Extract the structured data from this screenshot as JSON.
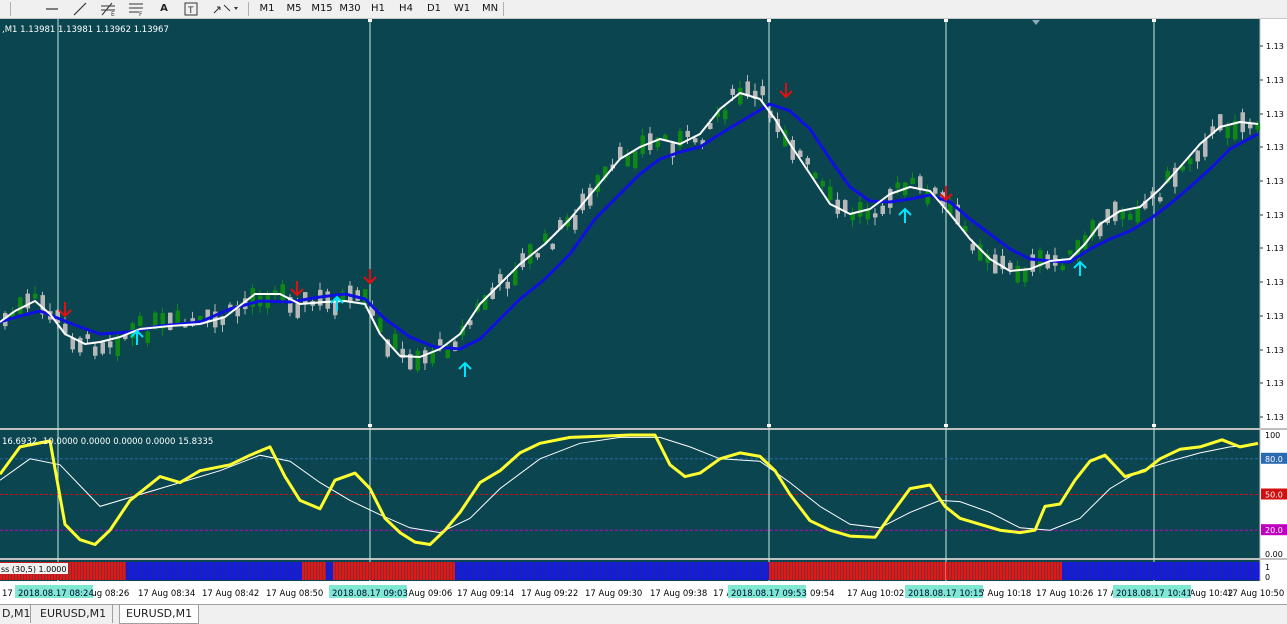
{
  "toolbar": {
    "tools": [
      "line-icon",
      "trendline-icon",
      "fibonacci-icon",
      "text-icon",
      "text-label-icon",
      "arrows-icon"
    ],
    "text_tool_label": "A",
    "timeframes": [
      "M1",
      "M5",
      "M15",
      "M30",
      "H1",
      "H4",
      "D1",
      "W1",
      "MN"
    ]
  },
  "chart": {
    "header": ",M1  1.13981 1.13981 1.13962 1.13967",
    "price_labels": [
      "1.13",
      "1.13",
      "1.13",
      "1.13",
      "1.13",
      "1.13",
      "1.13",
      "1.13",
      "1.13",
      "1.13",
      "1.13",
      "1.13"
    ],
    "colors": {
      "background": "#0b4650",
      "bull": "#0e8a14",
      "bear": "#b8b8b8",
      "fast_ma": "#ffffff",
      "slow_ma": "#1010e0",
      "up_arrow": "#00e5ff",
      "down_arrow": "#e01010"
    }
  },
  "oscillator": {
    "header": "16.6932 -10.0000 0.0000 0.0000 0.0000 15.8335",
    "levels": [
      {
        "label": "100",
        "color": "none"
      },
      {
        "label": "80.0",
        "color": "#2a6ab0"
      },
      {
        "label": "50.0",
        "color": "#d01010"
      },
      {
        "label": "20.0",
        "color": "#c000c0"
      },
      {
        "label": "0.00",
        "color": "none"
      }
    ],
    "line_color": "#ffff30",
    "signal_color": "#ffffff"
  },
  "strip": {
    "label": "ss (30,5) 1.0000",
    "scale_top": "1",
    "scale_bottom": "0"
  },
  "time_axis": {
    "labels": [
      "17 Aug 08:26",
      "17 Aug 08:34",
      "17 Aug 08:42",
      "17 Aug 08:50",
      "17 Aug 09:06",
      "17 Aug 09:14",
      "17 Aug 09:22",
      "17 Aug 09:30",
      "17 Aug 09:38",
      "17 A",
      "09:54",
      "17 Aug 10:02",
      "17 Aug 10:18",
      "17 Aug 10:26",
      "17 A",
      "17 Aug 10:42",
      "17 Aug 10:50"
    ],
    "left_stub": "17",
    "highlights": [
      "2018.08.17 08:24",
      "2018.08.17 09:03",
      "2018.08.17 09:53",
      "2018.08.17 10:15",
      "2018.08.17 10:41"
    ]
  },
  "tabs": [
    {
      "label": "D,M1",
      "active": false
    },
    {
      "label": "EURUSD,M1",
      "active": false
    },
    {
      "label": "EURUSD,M1",
      "active": true
    }
  ]
}
